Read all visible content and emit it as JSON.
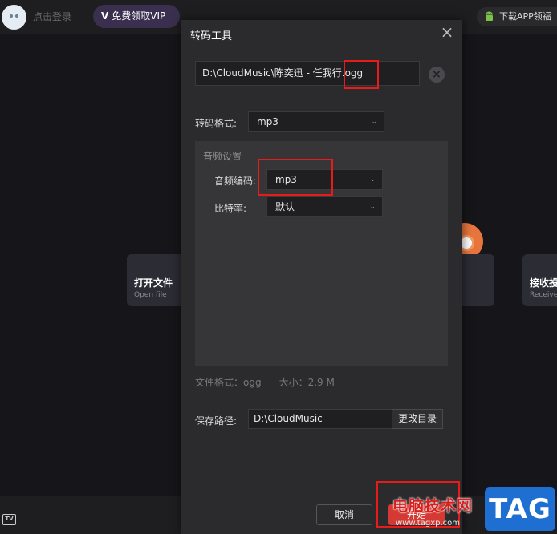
{
  "app": {
    "login_text": "点击登录",
    "vip_label": "免费领取VIP",
    "vip_icon": "V",
    "download_app": "下载APP领福",
    "cards": {
      "open": {
        "title": "打开文件",
        "subtitle": "Open file"
      },
      "receive": {
        "title": "接收投",
        "subtitle": "Receive"
      }
    },
    "tv_icon": "TV"
  },
  "dialog": {
    "title": "转码工具",
    "close_icon": "×",
    "file_path": "D:\\CloudMusic\\陈奕迅 - 任我行.ogg",
    "format_label": "转码格式:",
    "format_value": "mp3",
    "audio_settings_title": "音频设置",
    "codec_label": "音频编码:",
    "codec_value": "mp3",
    "bitrate_label": "比特率:",
    "bitrate_value": "默认",
    "file_format": "文件格式：ogg",
    "file_size": "大小：2.9 M",
    "save_label": "保存路径:",
    "save_path": "D:\\CloudMusic",
    "change_dir_label": "更改目录",
    "cancel_label": "取消",
    "start_label": "开始"
  },
  "watermark": {
    "site_name": "电脑技术网",
    "url": "www.tagxp.com",
    "tag": "TAG"
  },
  "colors": {
    "accent": "#d43a33",
    "highlight": "#e81b1b",
    "dialog_bg": "#2b2b2d",
    "tag_blue": "#1e6fd1"
  }
}
